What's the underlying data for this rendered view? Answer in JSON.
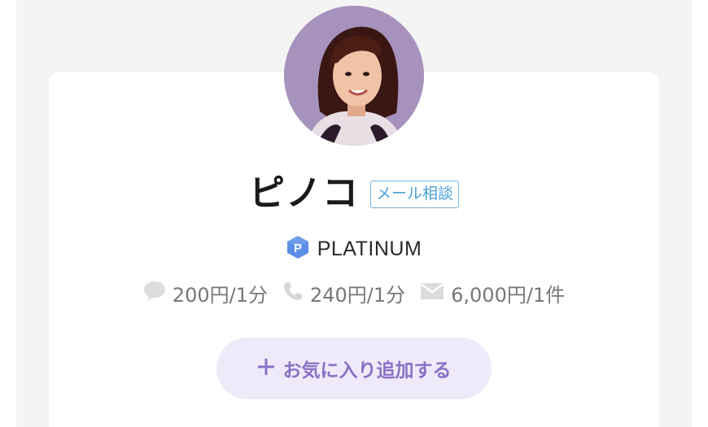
{
  "profile": {
    "name": "ピノコ",
    "badge": "メール相談",
    "rank": "PLATINUM",
    "rank_icon_letter": "P"
  },
  "prices": {
    "chat": "200円/1分",
    "phone": "240円/1分",
    "mail": "6,000円/1件"
  },
  "actions": {
    "favorite_label": "お気に入り追加する"
  },
  "colors": {
    "accent": "#8a70c6",
    "button_bg": "#efeaf9",
    "badge_border": "#74b3df",
    "rank_icon": "#5b8ee6",
    "avatar_bg": "#a792bd"
  },
  "icons": {
    "chat": "chat-bubble-icon",
    "phone": "phone-icon",
    "mail": "mail-icon",
    "rank": "platinum-hexagon-icon",
    "favorite": "plus-icon"
  }
}
